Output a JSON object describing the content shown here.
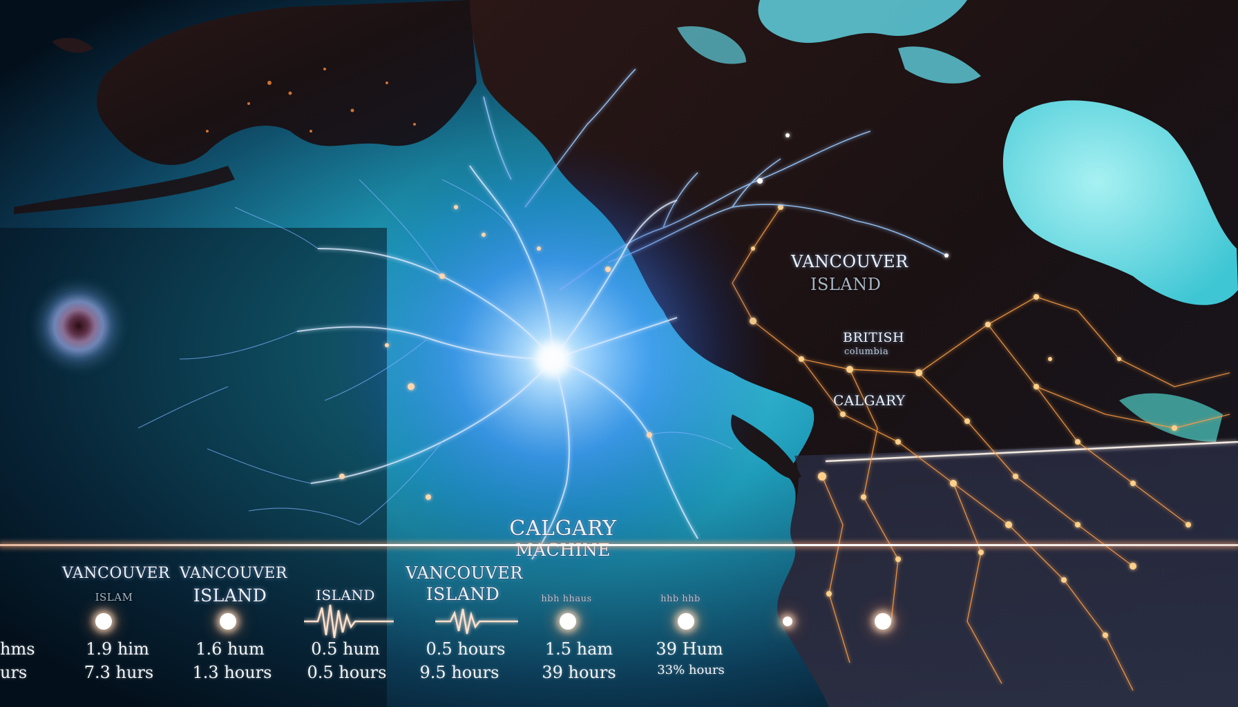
{
  "map": {
    "labels": {
      "vancouver_island_upper": "VANCOUVER",
      "vancouver_island_lower": "ISLAND",
      "british": "BRITISH",
      "british_sub": "columbia",
      "calgary": "CALGARY",
      "calgary_machine_line1": "CALGARY",
      "calgary_machine_line2": "MACHINE"
    },
    "colors": {
      "ocean": "#1e9bb8",
      "land": "#1a1012",
      "energy": "#6fb4ff",
      "city_lights": "#ffb25a"
    }
  },
  "timeline": {
    "stop_labels": [
      {
        "line1": "VANCOUVER",
        "line2": "ISLAM"
      },
      {
        "line1": "VANCOUVER",
        "line2": "ISLAND"
      },
      {
        "line1": "",
        "line2": "ISLAND"
      },
      {
        "line1": "VANCOUVER",
        "line2": "ISLAND"
      },
      {
        "line1": "",
        "line2": "hbh hhaus"
      },
      {
        "line1": "",
        "line2": "hhb hhb"
      }
    ],
    "times_row1": [
      "hms",
      "1.9 him",
      "1.6 hum",
      "0.5 hum",
      "0.5 hours",
      "1.5 ham",
      "39 Hum"
    ],
    "times_row2": [
      "urs",
      "7.3 hurs",
      "1.3 hours",
      "0.5 hours",
      "9.5 hours",
      "39 hours",
      "33% hours"
    ]
  }
}
